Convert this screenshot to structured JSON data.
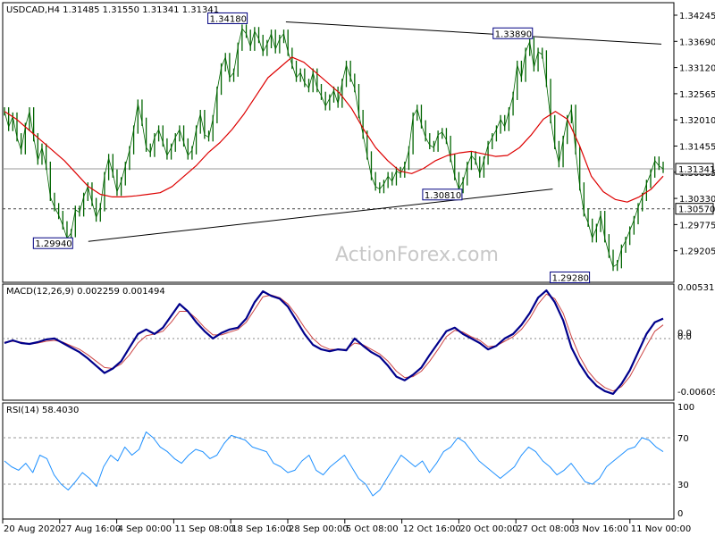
{
  "chart_data": [
    {
      "panel": "price",
      "type": "line",
      "header": "USDCAD,H4  1.31485 1.31550 1.31341 1.31341",
      "watermark": "ActionForex.com",
      "ylim": [
        1.2915,
        1.3455
      ],
      "yticks": [
        "1.34245",
        "1.33690",
        "1.33120",
        "1.32565",
        "1.32010",
        "1.31455",
        "1.30885",
        "1.30330",
        "1.29775",
        "1.29205"
      ],
      "current_price": "1.31341",
      "support_level": "1.30570",
      "series": [
        {
          "values": [
            1.3245,
            1.3215,
            1.3235,
            1.3195,
            1.317,
            1.3215,
            1.3245,
            1.3195,
            1.315,
            1.3175,
            1.314,
            1.308,
            1.306,
            1.3045,
            1.3025,
            1.3,
            1.301,
            1.3055,
            1.305,
            1.308,
            1.31,
            1.307,
            1.304,
            1.306,
            1.312,
            1.3155,
            1.3125,
            1.309,
            1.311,
            1.314,
            1.317,
            1.321,
            1.326,
            1.3225,
            1.3175,
            1.3165,
            1.3195,
            1.321,
            1.3185,
            1.316,
            1.3175,
            1.3195,
            1.321,
            1.3185,
            1.316,
            1.317,
            1.321,
            1.324,
            1.32,
            1.3195,
            1.323,
            1.3285,
            1.333,
            1.335,
            1.331,
            1.332,
            1.337,
            1.3405,
            1.3395,
            1.337,
            1.34,
            1.3385,
            1.336,
            1.3375,
            1.3395,
            1.3365,
            1.3385,
            1.3395,
            1.336,
            1.3335,
            1.331,
            1.332,
            1.33,
            1.329,
            1.332,
            1.329,
            1.3275,
            1.3255,
            1.327,
            1.3285,
            1.326,
            1.33,
            1.3335,
            1.331,
            1.329,
            1.324,
            1.32,
            1.316,
            1.312,
            1.31,
            1.3095,
            1.3105,
            1.312,
            1.311,
            1.313,
            1.3125,
            1.314,
            1.317,
            1.3235,
            1.325,
            1.322,
            1.3195,
            1.318,
            1.3175,
            1.32,
            1.3205,
            1.319,
            1.3155,
            1.312,
            1.3095,
            1.311,
            1.314,
            1.316,
            1.315,
            1.3125,
            1.315,
            1.318,
            1.3195,
            1.321,
            1.323,
            1.3215,
            1.3245,
            1.3275,
            1.3335,
            1.331,
            1.336,
            1.338,
            1.333,
            1.336,
            1.3355,
            1.33,
            1.323,
            1.318,
            1.3145,
            1.319,
            1.323,
            1.325,
            1.317,
            1.31,
            1.305,
            1.303,
            1.3,
            1.302,
            1.3045,
            1.3,
            1.297,
            1.2945,
            1.295,
            1.298,
            1.2995,
            1.3015,
            1.3035,
            1.306,
            1.308,
            1.3105,
            1.3125,
            1.315,
            1.314,
            1.3134
          ]
        },
        {
          "name": "MA",
          "color": "#dd0000",
          "values": [
            1.3245,
            1.323,
            1.321,
            1.319,
            1.317,
            1.315,
            1.3125,
            1.31,
            1.3085,
            1.308,
            1.308,
            1.3082,
            1.3085,
            1.3088,
            1.31,
            1.312,
            1.314,
            1.3165,
            1.3185,
            1.321,
            1.324,
            1.3275,
            1.331,
            1.333,
            1.335,
            1.334,
            1.332,
            1.33,
            1.328,
            1.325,
            1.321,
            1.3175,
            1.315,
            1.313,
            1.3125,
            1.3135,
            1.315,
            1.316,
            1.3165,
            1.3168,
            1.3163,
            1.3158,
            1.316,
            1.3175,
            1.32,
            1.323,
            1.3245,
            1.323,
            1.318,
            1.312,
            1.309,
            1.3075,
            1.307,
            1.308,
            1.3095,
            1.312
          ]
        }
      ],
      "annotations": [
        {
          "label": "1.34180",
          "value": 1.3418
        },
        {
          "label": "1.33890",
          "value": 1.3389
        },
        {
          "label": "1.30810",
          "value": 1.3081
        },
        {
          "label": "1.29940",
          "value": 1.2994
        },
        {
          "label": "1.29280",
          "value": 1.2928
        }
      ],
      "trendlines": [
        {
          "from": [
            0.43,
            1.3418
          ],
          "to": [
            1.0,
            1.3375
          ]
        },
        {
          "from": [
            0.13,
            1.2994
          ],
          "to": [
            0.835,
            1.3095
          ]
        }
      ]
    },
    {
      "panel": "macd",
      "type": "line",
      "header": "MACD(12,26,9) 0.002259 0.001494",
      "ylim": [
        -0.0068,
        0.006
      ],
      "yticks": [
        "0.005312",
        "0.0",
        "0.0",
        "-0.006092"
      ],
      "series": [
        {
          "name": "MACD",
          "color": "#00008b",
          "values": [
            -0.0005,
            -0.0002,
            -0.0005,
            -0.0006,
            -0.0004,
            -0.0001,
            0.0,
            -0.0005,
            -0.001,
            -0.0015,
            -0.0022,
            -0.003,
            -0.0038,
            -0.0033,
            -0.0025,
            -0.001,
            0.0005,
            0.001,
            0.0005,
            0.0012,
            0.0025,
            0.0038,
            0.003,
            0.0018,
            0.0008,
            0.0,
            0.0006,
            0.001,
            0.0012,
            0.0022,
            0.004,
            0.0052,
            0.0047,
            0.0044,
            0.0035,
            0.002,
            0.0005,
            -0.0007,
            -0.0012,
            -0.0014,
            -0.0012,
            -0.0013,
            0.0,
            -0.0008,
            -0.0015,
            -0.002,
            -0.003,
            -0.0042,
            -0.0046,
            -0.004,
            -0.0032,
            -0.0018,
            -0.0005,
            0.0008,
            0.0012,
            0.0005,
            0.0,
            -0.0005,
            -0.0012,
            -0.0008,
            0.0,
            0.0005,
            0.0015,
            0.0028,
            0.0045,
            0.0053,
            0.004,
            0.002,
            -0.001,
            -0.0028,
            -0.0042,
            -0.0052,
            -0.0058,
            -0.0061,
            -0.005,
            -0.0035,
            -0.0015,
            0.0005,
            0.0018,
            0.0022
          ]
        },
        {
          "name": "Signal",
          "color": "#cc4444",
          "values": [
            -0.0004,
            -0.0003,
            -0.0004,
            -0.0006,
            -0.0005,
            -0.0003,
            -0.0002,
            -0.0004,
            -0.0008,
            -0.0012,
            -0.0018,
            -0.0025,
            -0.0032,
            -0.0033,
            -0.0028,
            -0.0018,
            -0.0005,
            0.0003,
            0.0005,
            0.0008,
            0.0018,
            0.003,
            0.003,
            0.0022,
            0.0012,
            0.0004,
            0.0004,
            0.0007,
            0.001,
            0.0018,
            0.0032,
            0.0046,
            0.0048,
            0.0045,
            0.0038,
            0.0026,
            0.0012,
            0.0,
            -0.0008,
            -0.0012,
            -0.0012,
            -0.0012,
            -0.0005,
            -0.0007,
            -0.0012,
            -0.0017,
            -0.0025,
            -0.0036,
            -0.0043,
            -0.0042,
            -0.0036,
            -0.0025,
            -0.0012,
            0.0002,
            0.0009,
            0.0007,
            0.0002,
            -0.0002,
            -0.0009,
            -0.0008,
            -0.0003,
            0.0002,
            0.001,
            0.0022,
            0.0038,
            0.0049,
            0.0044,
            0.0028,
            0.0002,
            -0.002,
            -0.0036,
            -0.0047,
            -0.0054,
            -0.0058,
            -0.0053,
            -0.0042,
            -0.0025,
            -0.0008,
            0.0008,
            0.0015
          ]
        }
      ]
    },
    {
      "panel": "rsi",
      "type": "line",
      "header": "RSI(14) 58.4030",
      "ylim": [
        0,
        100
      ],
      "yticks": [
        "100",
        "70",
        "30",
        "0"
      ],
      "levels": [
        70,
        30
      ],
      "series": [
        {
          "name": "RSI",
          "color": "#1e90ff",
          "values": [
            50,
            45,
            42,
            48,
            40,
            55,
            52,
            38,
            30,
            25,
            32,
            40,
            35,
            28,
            45,
            55,
            50,
            62,
            55,
            60,
            75,
            70,
            62,
            58,
            52,
            48,
            55,
            60,
            58,
            52,
            55,
            65,
            72,
            70,
            68,
            62,
            60,
            58,
            48,
            45,
            40,
            42,
            50,
            55,
            42,
            38,
            45,
            50,
            55,
            45,
            35,
            30,
            20,
            25,
            35,
            45,
            55,
            50,
            45,
            50,
            40,
            48,
            58,
            62,
            70,
            66,
            58,
            50,
            45,
            40,
            35,
            40,
            45,
            55,
            62,
            58,
            50,
            45,
            38,
            42,
            48,
            40,
            32,
            30,
            35,
            45,
            50,
            55,
            60,
            62,
            70,
            68,
            62,
            58
          ]
        }
      ]
    }
  ],
  "x_axis": {
    "labels": [
      "20 Aug 2020",
      "27 Aug 16:00",
      "4 Sep 00:00",
      "11 Sep 08:00",
      "18 Sep 16:00",
      "28 Sep 00:00",
      "5 Oct 08:00",
      "12 Oct 16:00",
      "20 Oct 00:00",
      "27 Oct 08:00",
      "3 Nov 16:00",
      "11 Nov 00:00"
    ]
  }
}
